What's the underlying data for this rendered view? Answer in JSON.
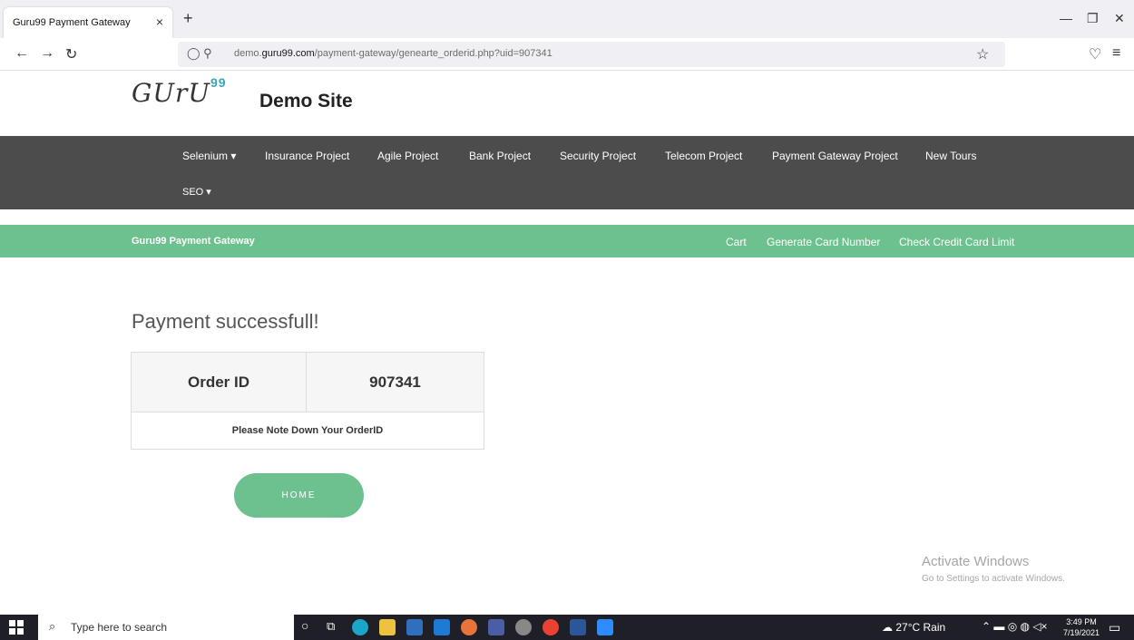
{
  "browser": {
    "tab_title": "Guru99 Payment Gateway",
    "tab_close": "×",
    "new_tab": "+",
    "url_domain_prefix": "demo.",
    "url_domain": "guru99.com",
    "url_path": "/payment-gateway/genearte_orderid.php?uid=907341"
  },
  "site": {
    "logo_text": "GUrU",
    "logo_sup": "99",
    "title": "Demo Site"
  },
  "menu": {
    "items": [
      "Selenium ▾",
      "Insurance Project",
      "Agile Project",
      "Bank Project",
      "Security Project",
      "Telecom Project",
      "Payment Gateway Project",
      "New Tours"
    ],
    "seo": "SEO ▾"
  },
  "gateway": {
    "brand": "Guru99 Payment Gateway",
    "links": [
      "Cart",
      "Generate Card Number",
      "Check Credit Card Limit"
    ]
  },
  "content": {
    "success_message": "Payment successfull!",
    "order_label": "Order ID",
    "order_value": "907341",
    "note": "Please Note Down Your OrderID",
    "home_button": "HOME"
  },
  "watermark": {
    "title": "Activate Windows",
    "subtitle": "Go to Settings to activate Windows."
  },
  "taskbar": {
    "search_placeholder": "Type here to search",
    "weather": "27°C Rain",
    "time": "3:49 PM",
    "date": "7/19/2021"
  }
}
